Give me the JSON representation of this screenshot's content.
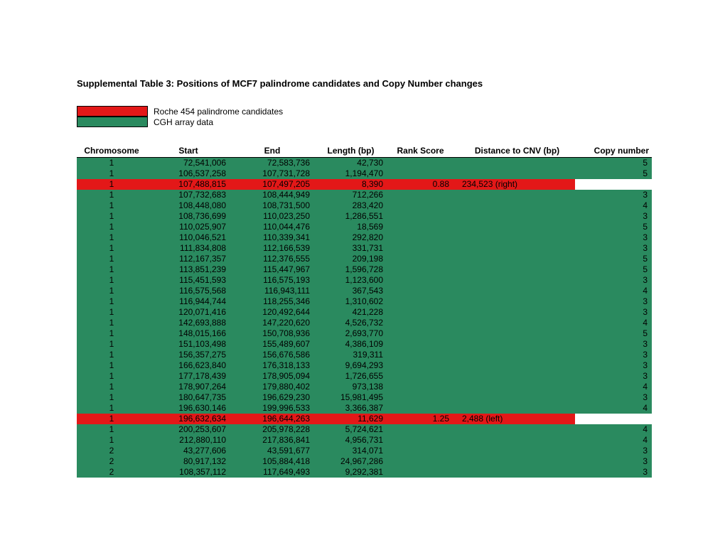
{
  "title": "Supplemental Table 3: Positions of  MCF7 palindrome candidates and Copy Number changes",
  "legend": {
    "red": "Roche 454 palindrome candidates",
    "green": "CGH array data"
  },
  "columns": {
    "chromosome": "Chromosome",
    "start": "Start",
    "end": "End",
    "length": "Length (bp)",
    "rank": "Rank Score",
    "distance": "Distance to CNV (bp)",
    "copy": "Copy number"
  },
  "rows": [
    {
      "type": "green",
      "chromosome": "1",
      "start": "72,541,006",
      "end": "72,583,736",
      "length": "42,730",
      "rank": "",
      "distance": "",
      "copy": "5"
    },
    {
      "type": "green",
      "chromosome": "1",
      "start": "106,537,258",
      "end": "107,731,728",
      "length": "1,194,470",
      "rank": "",
      "distance": "",
      "copy": "5"
    },
    {
      "type": "red",
      "chromosome": "1",
      "start": "107,488,815",
      "end": "107,497,205",
      "length": "8,390",
      "rank": "0.88",
      "distance": "234,523 (right)",
      "copy": ""
    },
    {
      "type": "green",
      "chromosome": "1",
      "start": "107,732,683",
      "end": "108,444,949",
      "length": "712,266",
      "rank": "",
      "distance": "",
      "copy": "3"
    },
    {
      "type": "green",
      "chromosome": "1",
      "start": "108,448,080",
      "end": "108,731,500",
      "length": "283,420",
      "rank": "",
      "distance": "",
      "copy": "4"
    },
    {
      "type": "green",
      "chromosome": "1",
      "start": "108,736,699",
      "end": "110,023,250",
      "length": "1,286,551",
      "rank": "",
      "distance": "",
      "copy": "3"
    },
    {
      "type": "green",
      "chromosome": "1",
      "start": "110,025,907",
      "end": "110,044,476",
      "length": "18,569",
      "rank": "",
      "distance": "",
      "copy": "5"
    },
    {
      "type": "green",
      "chromosome": "1",
      "start": "110,046,521",
      "end": "110,339,341",
      "length": "292,820",
      "rank": "",
      "distance": "",
      "copy": "3"
    },
    {
      "type": "green",
      "chromosome": "1",
      "start": "111,834,808",
      "end": "112,166,539",
      "length": "331,731",
      "rank": "",
      "distance": "",
      "copy": "3"
    },
    {
      "type": "green",
      "chromosome": "1",
      "start": "112,167,357",
      "end": "112,376,555",
      "length": "209,198",
      "rank": "",
      "distance": "",
      "copy": "5"
    },
    {
      "type": "green",
      "chromosome": "1",
      "start": "113,851,239",
      "end": "115,447,967",
      "length": "1,596,728",
      "rank": "",
      "distance": "",
      "copy": "5"
    },
    {
      "type": "green",
      "chromosome": "1",
      "start": "115,451,593",
      "end": "116,575,193",
      "length": "1,123,600",
      "rank": "",
      "distance": "",
      "copy": "3"
    },
    {
      "type": "green",
      "chromosome": "1",
      "start": "116,575,568",
      "end": "116,943,111",
      "length": "367,543",
      "rank": "",
      "distance": "",
      "copy": "4"
    },
    {
      "type": "green",
      "chromosome": "1",
      "start": "116,944,744",
      "end": "118,255,346",
      "length": "1,310,602",
      "rank": "",
      "distance": "",
      "copy": "3"
    },
    {
      "type": "green",
      "chromosome": "1",
      "start": "120,071,416",
      "end": "120,492,644",
      "length": "421,228",
      "rank": "",
      "distance": "",
      "copy": "3"
    },
    {
      "type": "green",
      "chromosome": "1",
      "start": "142,693,888",
      "end": "147,220,620",
      "length": "4,526,732",
      "rank": "",
      "distance": "",
      "copy": "4"
    },
    {
      "type": "green",
      "chromosome": "1",
      "start": "148,015,166",
      "end": "150,708,936",
      "length": "2,693,770",
      "rank": "",
      "distance": "",
      "copy": "5"
    },
    {
      "type": "green",
      "chromosome": "1",
      "start": "151,103,498",
      "end": "155,489,607",
      "length": "4,386,109",
      "rank": "",
      "distance": "",
      "copy": "3"
    },
    {
      "type": "green",
      "chromosome": "1",
      "start": "156,357,275",
      "end": "156,676,586",
      "length": "319,311",
      "rank": "",
      "distance": "",
      "copy": "3"
    },
    {
      "type": "green",
      "chromosome": "1",
      "start": "166,623,840",
      "end": "176,318,133",
      "length": "9,694,293",
      "rank": "",
      "distance": "",
      "copy": "3"
    },
    {
      "type": "green",
      "chromosome": "1",
      "start": "177,178,439",
      "end": "178,905,094",
      "length": "1,726,655",
      "rank": "",
      "distance": "",
      "copy": "3"
    },
    {
      "type": "green",
      "chromosome": "1",
      "start": "178,907,264",
      "end": "179,880,402",
      "length": "973,138",
      "rank": "",
      "distance": "",
      "copy": "4"
    },
    {
      "type": "green",
      "chromosome": "1",
      "start": "180,647,735",
      "end": "196,629,230",
      "length": "15,981,495",
      "rank": "",
      "distance": "",
      "copy": "3"
    },
    {
      "type": "green",
      "chromosome": "1",
      "start": "196,630,146",
      "end": "199,996,533",
      "length": "3,366,387",
      "rank": "",
      "distance": "",
      "copy": "4"
    },
    {
      "type": "red",
      "chromosome": "1",
      "start": "196,632,634",
      "end": "196,644,263",
      "length": "11,629",
      "rank": "1.25",
      "distance": "2,488 (left)",
      "copy": ""
    },
    {
      "type": "green",
      "chromosome": "1",
      "start": "200,253,607",
      "end": "205,978,228",
      "length": "5,724,621",
      "rank": "",
      "distance": "",
      "copy": "4"
    },
    {
      "type": "green",
      "chromosome": "1",
      "start": "212,880,110",
      "end": "217,836,841",
      "length": "4,956,731",
      "rank": "",
      "distance": "",
      "copy": "4"
    },
    {
      "type": "green",
      "chromosome": "2",
      "start": "43,277,606",
      "end": "43,591,677",
      "length": "314,071",
      "rank": "",
      "distance": "",
      "copy": "3"
    },
    {
      "type": "green",
      "chromosome": "2",
      "start": "80,917,132",
      "end": "105,884,418",
      "length": "24,967,286",
      "rank": "",
      "distance": "",
      "copy": "3"
    },
    {
      "type": "green",
      "chromosome": "2",
      "start": "108,357,112",
      "end": "117,649,493",
      "length": "9,292,381",
      "rank": "",
      "distance": "",
      "copy": "3"
    }
  ]
}
